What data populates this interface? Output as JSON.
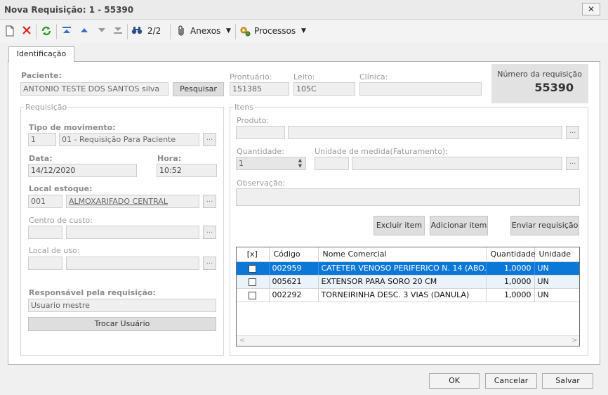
{
  "window": {
    "title": "Nova Requisição: 1 - 55390",
    "close_label": "✕"
  },
  "toolbar": {
    "icons": [
      "new-document-icon",
      "delete-icon",
      "refresh-icon",
      "first-record-icon",
      "previous-record-icon",
      "next-record-icon",
      "last-record-icon",
      "search-binoculars-icon",
      "attachment-icon",
      "processes-icon"
    ],
    "record_counter": "2/2",
    "anexos_label": "Anexos",
    "processos_label": "Processos"
  },
  "tabs": [
    {
      "label": "Identificação",
      "active": true
    }
  ],
  "patient": {
    "paciente_label": "Paciente:",
    "paciente_value": "ANTONIO TESTE DOS SANTOS silva",
    "pesquisar_label": "Pesquisar",
    "prontuario_label": "Prontuário:",
    "prontuario_value": "151385",
    "leito_label": "Leito:",
    "leito_value": "105C",
    "clinica_label": "Clínica:",
    "clinica_value": ""
  },
  "request_number": {
    "label": "Número da requisição",
    "value": "55390"
  },
  "requisicao": {
    "legend": "Requisição",
    "tipo_label": "Tipo de movimento:",
    "tipo_code": "1",
    "tipo_desc": "01 - Requisição Para Paciente",
    "data_label": "Data:",
    "data_value": "14/12/2020",
    "hora_label": "Hora:",
    "hora_value": "10:52",
    "local_estoque_label": "Local estoque:",
    "local_estoque_code": "001",
    "local_estoque_desc": "ALMOXARIFADO CENTRAL",
    "centro_custo_label": "Centro de custo:",
    "local_uso_label": "Local de uso:",
    "responsavel_label": "Responsável pela requisição:",
    "responsavel_value": "Usuario mestre",
    "trocar_label": "Trocar Usuário",
    "ellipsis": "..."
  },
  "itens": {
    "legend": "Itens",
    "produto_label": "Produto:",
    "quantidade_label": "Quantidade:",
    "quantidade_value": "1",
    "unidade_label": "Unidade de medida(Faturamento):",
    "observacao_label": "Observação:",
    "excluir_label": "Excluir item",
    "adicionar_label": "Adicionar item",
    "enviar_label": "Enviar requisição"
  },
  "grid": {
    "headers": [
      "[x]",
      "Código",
      "Nome Comercial",
      "Quantidade",
      "Unidade"
    ],
    "rows": [
      {
        "checked": false,
        "codigo": "002959",
        "nome": "CATETER VENOSO PERIFERICO N. 14 (ABO...",
        "quantidade": "1,0000",
        "unidade": "UN",
        "selected": true
      },
      {
        "checked": false,
        "codigo": "005621",
        "nome": "EXTENSOR PARA SORO 20 CM",
        "quantidade": "1,0000",
        "unidade": "UN",
        "selected": false
      },
      {
        "checked": false,
        "codigo": "002292",
        "nome": "TORNEIRINHA DESC. 3 VIAS (DANULA)",
        "quantidade": "1,0000",
        "unidade": "UN",
        "selected": false
      }
    ]
  },
  "footer": {
    "ok_label": "OK",
    "cancelar_label": "Cancelar",
    "salvar_label": "Salvar"
  },
  "colors": {
    "selection": "#0b78d7",
    "panel": "#ffffff",
    "field": "#efefef"
  }
}
